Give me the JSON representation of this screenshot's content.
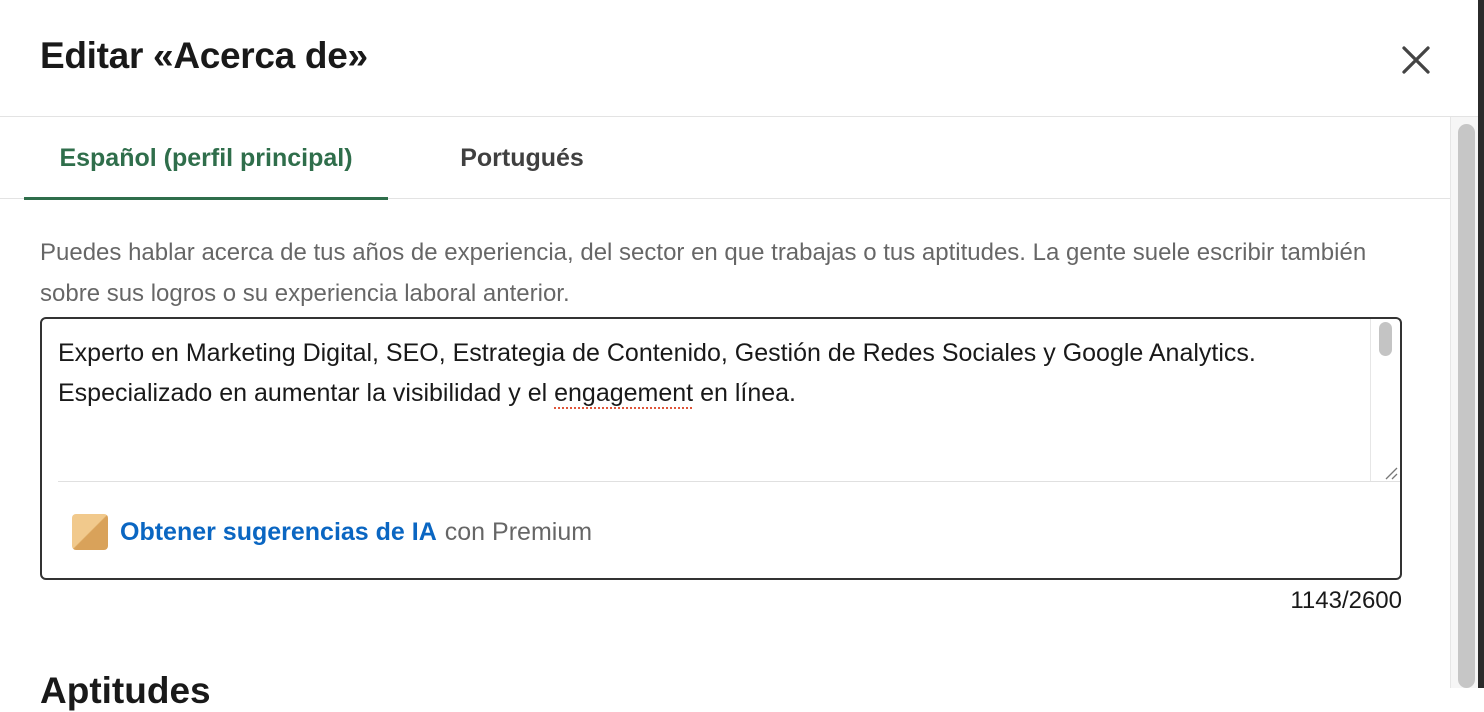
{
  "dialog": {
    "title": "Editar «Acerca de»",
    "close_icon": "close-icon"
  },
  "tabs": [
    {
      "label": "Español (perfil principal)",
      "active": true
    },
    {
      "label": "Portugués",
      "active": false
    }
  ],
  "helper_text": "Puedes hablar acerca de tus años de experiencia, del sector en que trabajas o tus aptitudes. La gente suele escribir también sobre sus logros o su experiencia laboral anterior.",
  "about_field": {
    "value_part1": "Experto en Marketing Digital, SEO, Estrategia de Contenido, Gestión de Redes Sociales y Google Analytics. Especializado en aumentar la visibilidad y el ",
    "value_flagged": "engagement",
    "value_part2": " en línea.",
    "ai_link": "Obtener sugerencias de IA",
    "ai_suffix": "con Premium",
    "premium_icon": "premium-badge-icon"
  },
  "char_counter": "1143/2600",
  "next_section_title": "Aptitudes",
  "colors": {
    "active_tab": "#2f6e4b",
    "link": "#0a66c2",
    "spell_underline": "#e0573b"
  }
}
